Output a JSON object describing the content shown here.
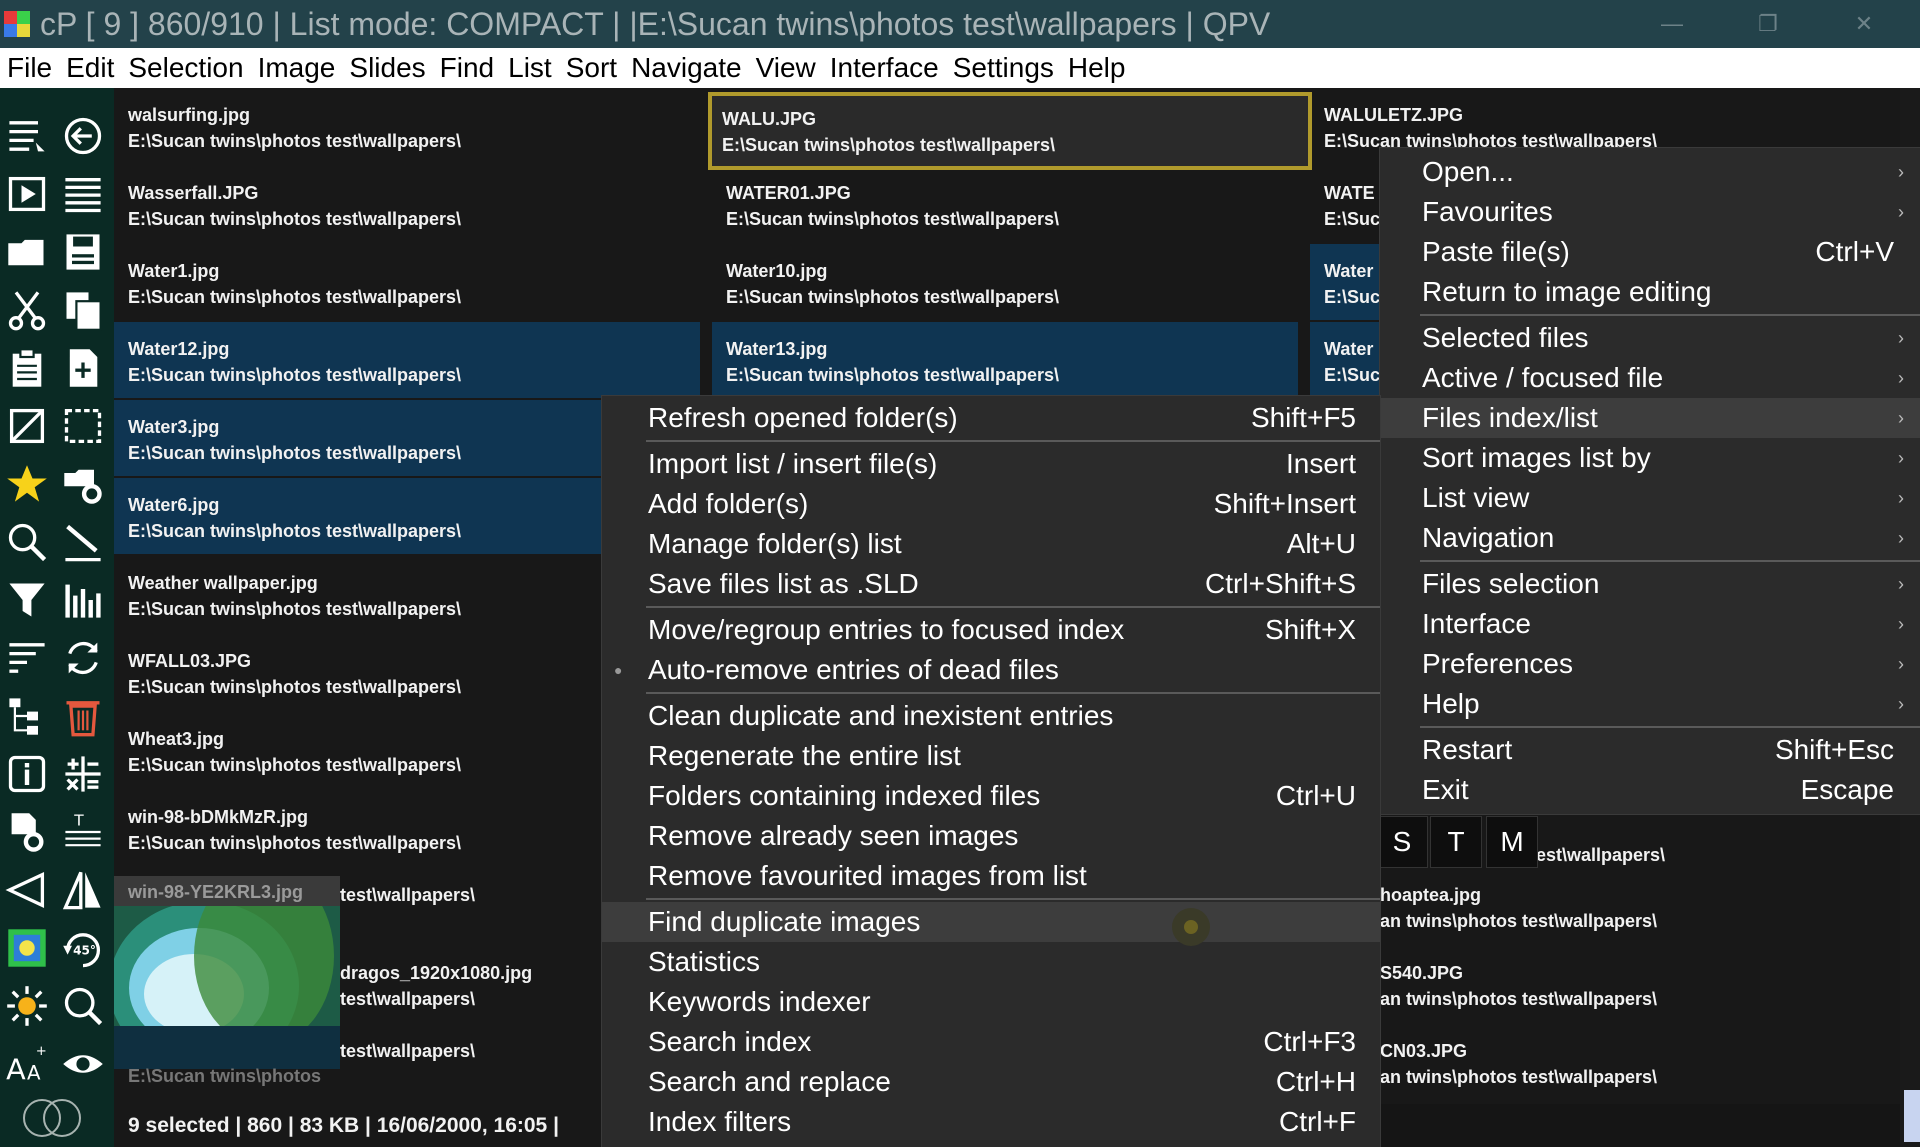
{
  "window": {
    "title": "cP [ 9 ] 860/910 | List mode: COMPACT | |E:\\Sucan twins\\photos test\\wallpapers | QPV",
    "minimize": "—",
    "maximize": "❐",
    "close": "✕"
  },
  "menubar": [
    "File",
    "Edit",
    "Selection",
    "Image",
    "Slides",
    "Find",
    "List",
    "Sort",
    "Navigate",
    "View",
    "Interface",
    "Settings",
    "Help"
  ],
  "list": {
    "col1": [
      {
        "name": "walsurfing.jpg",
        "path": "E:\\Sucan twins\\photos test\\wallpapers\\"
      },
      {
        "name": "Wasserfall.JPG",
        "path": "E:\\Sucan twins\\photos test\\wallpapers\\"
      },
      {
        "name": "Water1.jpg",
        "path": "E:\\Sucan twins\\photos test\\wallpapers\\"
      },
      {
        "name": "Water12.jpg",
        "path": "E:\\Sucan twins\\photos test\\wallpapers\\"
      },
      {
        "name": "Water3.jpg",
        "path": "E:\\Sucan twins\\photos test\\wallpapers\\"
      },
      {
        "name": "Water6.jpg",
        "path": "E:\\Sucan twins\\photos test\\wallpapers\\"
      },
      {
        "name": "Weather wallpaper.jpg",
        "path": "E:\\Sucan twins\\photos test\\wallpapers\\"
      },
      {
        "name": "WFALL03.JPG",
        "path": "E:\\Sucan twins\\photos test\\wallpapers\\"
      },
      {
        "name": "Wheat3.jpg",
        "path": "E:\\Sucan twins\\photos test\\wallpapers\\"
      },
      {
        "name": "win-98-bDMkMzR.jpg",
        "path": "E:\\Sucan twins\\photos test\\wallpapers\\"
      },
      {
        "name": "",
        "path": "test\\wallpapers\\"
      },
      {
        "name": "dragos_1920x1080.jpg",
        "path": "test\\wallpapers\\"
      },
      {
        "name": "",
        "path": "test\\wallpapers\\"
      }
    ],
    "col2": [
      {
        "name": "WALU.JPG",
        "path": "E:\\Sucan twins\\photos test\\wallpapers\\"
      },
      {
        "name": "WATER01.JPG",
        "path": "E:\\Sucan twins\\photos test\\wallpapers\\"
      },
      {
        "name": "Water10.jpg",
        "path": "E:\\Sucan twins\\photos test\\wallpapers\\"
      },
      {
        "name": "Water13.jpg",
        "path": "E:\\Sucan twins\\photos test\\wallpapers\\"
      }
    ],
    "col3": [
      {
        "name": "WALULETZ.JPG",
        "path": "E:\\Sucan twins\\photos test\\wallpapers\\"
      },
      {
        "name": "WATE",
        "path": "E:\\Suc"
      },
      {
        "name": "Water",
        "path": "E:\\Suc"
      },
      {
        "name": "Water",
        "path": "E:\\Suc"
      }
    ],
    "col3_lower": [
      {
        "name": "",
        "path": "est\\wallpapers\\"
      },
      {
        "name": "hoaptea.jpg",
        "path": "an twins\\photos test\\wallpapers\\"
      },
      {
        "name": "S540.JPG",
        "path": "an twins\\photos test\\wallpapers\\"
      },
      {
        "name": "CN03.JPG",
        "path": "an twins\\photos test\\wallpapers\\"
      }
    ],
    "thumb_name": "win-98-YE2KRL3.jpg",
    "thumb_path": "E:\\Sucan twins\\photos"
  },
  "status": "9 selected | 860 | 83 KB | 16/06/2000, 16:05 |",
  "stm_buttons": [
    "S",
    "T",
    "M"
  ],
  "main_menu": [
    {
      "label": "Open...",
      "shortcut": "",
      "arrow": true
    },
    {
      "label": "Favourites",
      "shortcut": "",
      "arrow": true
    },
    {
      "label": "Paste file(s)",
      "shortcut": "Ctrl+V",
      "arrow": false
    },
    {
      "label": "Return to image editing",
      "shortcut": "",
      "arrow": false
    },
    {
      "label": "Selected files",
      "shortcut": "",
      "arrow": true
    },
    {
      "label": "Active / focused file",
      "shortcut": "",
      "arrow": true
    },
    {
      "label": "Files index/list",
      "shortcut": "",
      "arrow": true
    },
    {
      "label": "Sort images list by",
      "shortcut": "",
      "arrow": true
    },
    {
      "label": "List view",
      "shortcut": "",
      "arrow": true
    },
    {
      "label": "Navigation",
      "shortcut": "",
      "arrow": true
    },
    {
      "label": "Files selection",
      "shortcut": "",
      "arrow": true
    },
    {
      "label": "Interface",
      "shortcut": "",
      "arrow": true
    },
    {
      "label": "Preferences",
      "shortcut": "",
      "arrow": true
    },
    {
      "label": "Help",
      "shortcut": "",
      "arrow": true
    },
    {
      "label": "Restart",
      "shortcut": "Shift+Esc",
      "arrow": false
    },
    {
      "label": "Exit",
      "shortcut": "Escape",
      "arrow": false
    }
  ],
  "sub_menu": [
    {
      "label": "Refresh opened folder(s)",
      "shortcut": "Shift+F5"
    },
    {
      "label": "Import list / insert file(s)",
      "shortcut": "Insert"
    },
    {
      "label": "Add folder(s)",
      "shortcut": "Shift+Insert"
    },
    {
      "label": "Manage folder(s) list",
      "shortcut": "Alt+U"
    },
    {
      "label": "Save files list as .SLD",
      "shortcut": "Ctrl+Shift+S"
    },
    {
      "label": "Move/regroup entries to focused index",
      "shortcut": "Shift+X"
    },
    {
      "label": "Auto-remove entries of dead files",
      "shortcut": ""
    },
    {
      "label": "Clean duplicate and inexistent entries",
      "shortcut": ""
    },
    {
      "label": "Regenerate the entire list",
      "shortcut": ""
    },
    {
      "label": "Folders containing indexed files",
      "shortcut": "Ctrl+U"
    },
    {
      "label": "Remove already seen images",
      "shortcut": ""
    },
    {
      "label": "Remove favourited images from list",
      "shortcut": ""
    },
    {
      "label": "Find duplicate images",
      "shortcut": ""
    },
    {
      "label": "Statistics",
      "shortcut": ""
    },
    {
      "label": "Keywords indexer",
      "shortcut": ""
    },
    {
      "label": "Search index",
      "shortcut": "Ctrl+F3"
    },
    {
      "label": "Search and replace",
      "shortcut": "Ctrl+H"
    },
    {
      "label": "Index filters",
      "shortcut": "Ctrl+F"
    }
  ],
  "colors": {
    "titlebar": "#23424a",
    "toolbar": "#0a2a24",
    "selected": "#0f3552",
    "focus_border": "#b09a2c",
    "menu_bg": "#2b2b2b"
  }
}
